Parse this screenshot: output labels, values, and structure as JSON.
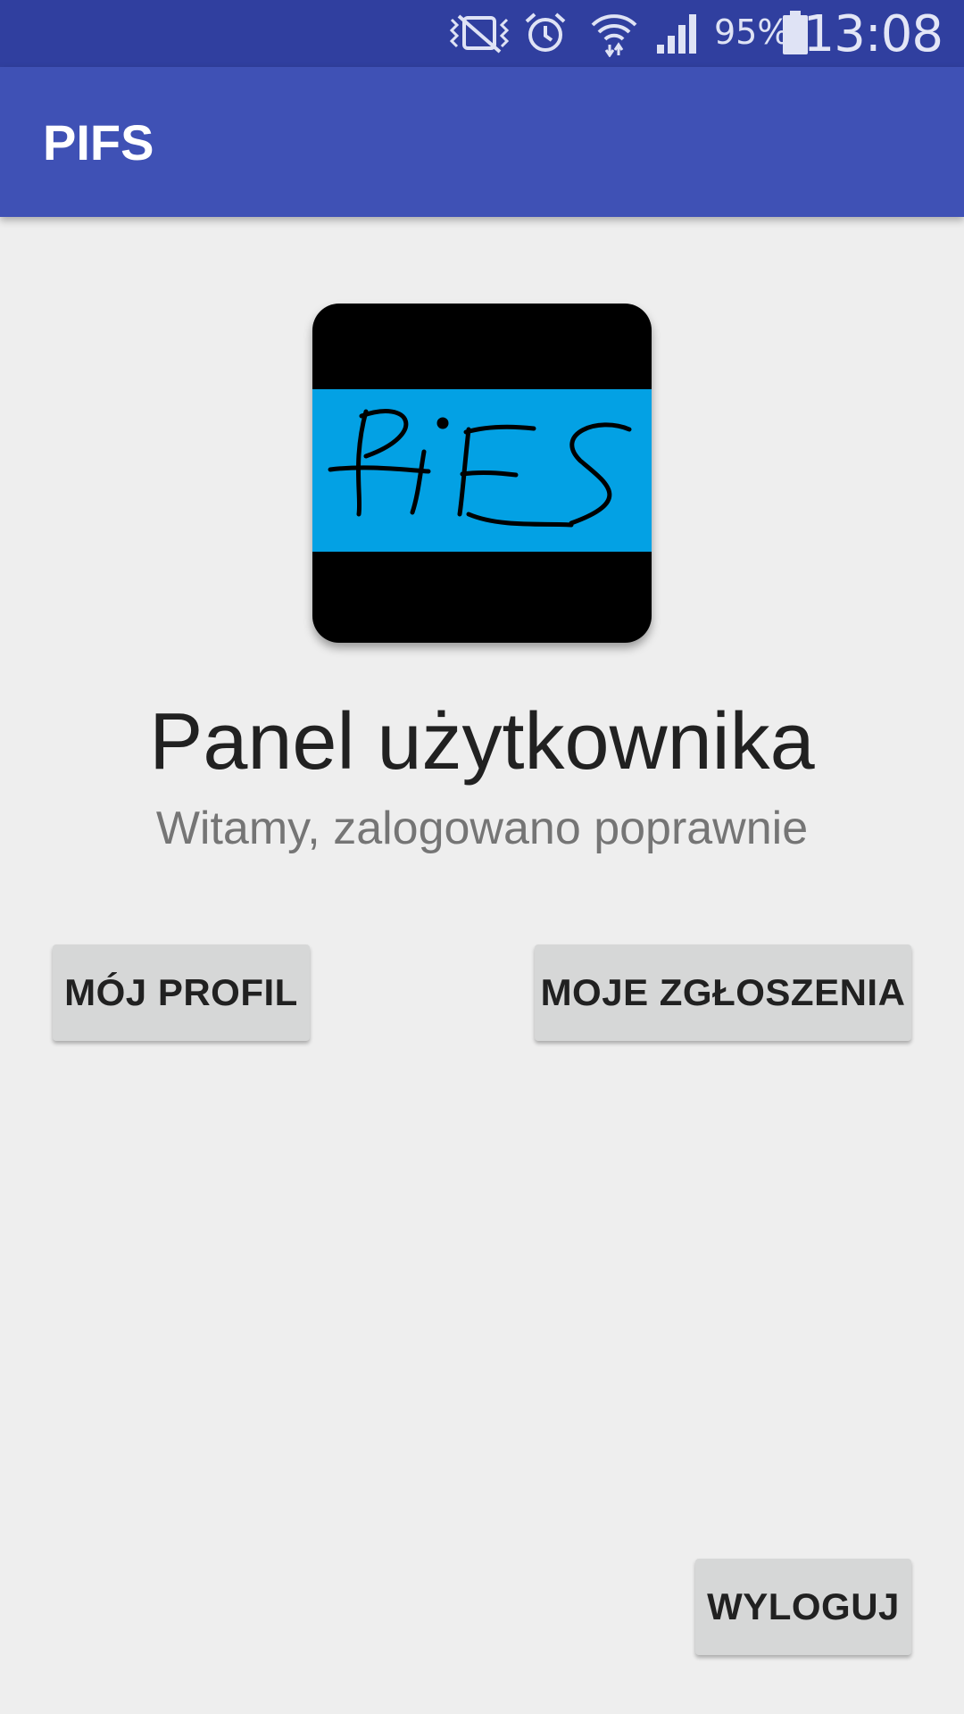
{
  "status_bar": {
    "battery": "95%",
    "time": "13:08",
    "icons": [
      "vibrate-mute-icon",
      "alarm-icon",
      "wifi-icon",
      "signal-icon",
      "battery-icon"
    ]
  },
  "app_bar": {
    "title": "PIFS"
  },
  "logo": {
    "text": "PIFS",
    "band_color": "#03a1e4",
    "background_color": "#000000"
  },
  "panel": {
    "title": "Panel użytkownika",
    "subtitle": "Witamy, zalogowano poprawnie"
  },
  "buttons": {
    "profile": "MÓJ PROFIL",
    "reports": "MOJE ZGŁOSZENIA",
    "logout": "WYLOGUJ"
  },
  "colors": {
    "primary": "#3f51b5",
    "primary_dark": "#303f9f",
    "background": "#eeeeee",
    "button": "#d6d7d7"
  }
}
